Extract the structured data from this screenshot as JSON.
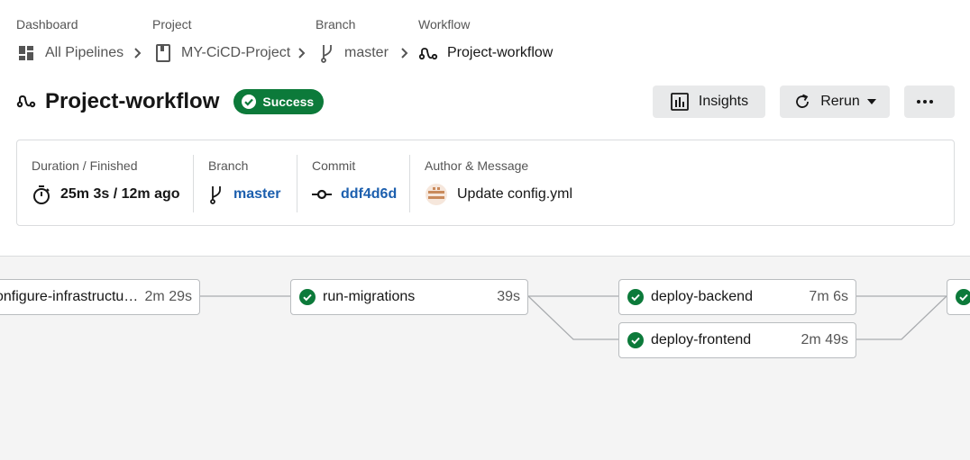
{
  "breadcrumb": {
    "labels": {
      "dashboard": "Dashboard",
      "project": "Project",
      "branch": "Branch",
      "workflow": "Workflow"
    },
    "items": {
      "dashboard": "All Pipelines",
      "project": "MY-CiCD-Project",
      "branch": "master",
      "workflow": "Project-workflow"
    }
  },
  "header": {
    "title": "Project-workflow",
    "status": "Success",
    "status_color": "#0c7a3a",
    "insights_label": "Insights",
    "rerun_label": "Rerun"
  },
  "info": {
    "duration_label": "Duration / Finished",
    "duration_value": "25m 3s / 12m ago",
    "branch_label": "Branch",
    "branch_value": "master",
    "commit_label": "Commit",
    "commit_value": "ddf4d6d",
    "author_label": "Author & Message",
    "message": "Update config.yml",
    "link_color": "#1c5fae"
  },
  "jobs": [
    {
      "name": "configure-infrastructu…",
      "duration": "2m 29s",
      "status": "success"
    },
    {
      "name": "run-migrations",
      "duration": "39s",
      "status": "success"
    },
    {
      "name": "deploy-backend",
      "duration": "7m 6s",
      "status": "success"
    },
    {
      "name": "deploy-frontend",
      "duration": "2m 49s",
      "status": "success"
    },
    {
      "name": "",
      "duration": "",
      "status": "success"
    }
  ],
  "icons": {
    "dashboard": "dashboard-grid-icon",
    "project": "book-icon",
    "branch": "git-branch-icon",
    "workflow": "workflow-icon",
    "timer": "stopwatch-icon",
    "commit": "git-commit-icon",
    "insights": "bar-chart-icon",
    "rerun": "refresh-icon",
    "more": "ellipsis-icon",
    "success": "check-circle-icon"
  }
}
